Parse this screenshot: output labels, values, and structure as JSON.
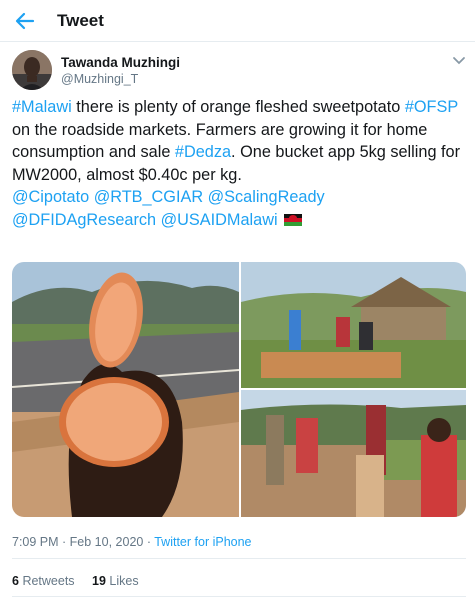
{
  "header": {
    "title": "Tweet",
    "back_icon": "arrow-left-icon"
  },
  "author": {
    "name": "Tawanda Muzhingi",
    "handle": "@Muzhingi_T"
  },
  "tweet": {
    "hashtag_malawi": "#Malawi",
    "text_1": " there is plenty of orange fleshed sweetpotato ",
    "hashtag_ofsp": "#OFSP",
    "text_2": " on the roadside markets. Farmers are growing it for home consumption and sale ",
    "hashtag_dedza": "#Dedza",
    "text_3": ". One bucket app 5kg selling for MW2000, almost $0.40c per kg.",
    "mentions": [
      "@Cipotato",
      "@RTB_CGIAR",
      "@ScalingReady",
      "@DFIDAgResearch",
      "@USAIDMalawi"
    ],
    "flag": "malawi-flag"
  },
  "meta": {
    "time": "7:09 PM",
    "separator": " · ",
    "date": "Feb 10, 2020",
    "source": "Twitter for iPhone"
  },
  "stats": {
    "retweets_count": "6",
    "retweets_label": "Retweets",
    "likes_count": "19",
    "likes_label": "Likes"
  },
  "colors": {
    "link": "#1da1f2",
    "secondary": "#657786",
    "divider": "#e6ecf0"
  }
}
